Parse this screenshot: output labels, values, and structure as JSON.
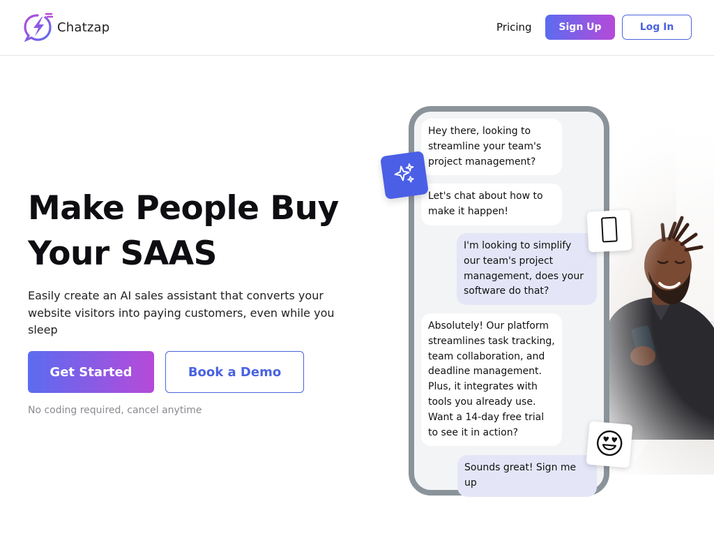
{
  "header": {
    "brand": "Chatzap",
    "nav_pricing": "Pricing",
    "signup_label": "Sign Up",
    "login_label": "Log In"
  },
  "hero": {
    "title_line1": "Make People Buy",
    "title_line2": "Your SAAS",
    "subtitle": "Easily create an AI sales assistant that converts your website visitors into paying customers, even while you sleep",
    "primary_cta": "Get Started",
    "secondary_cta": "Book a Demo",
    "note": "No coding required, cancel anytime"
  },
  "chat": {
    "messages": [
      {
        "from": "bot",
        "text": "Hey there, looking to streamline your team's project management?"
      },
      {
        "from": "bot",
        "text": "Let's chat about how to make it happen!"
      },
      {
        "from": "user",
        "text": "I'm looking to simplify our team's project management, does your software do that?"
      },
      {
        "from": "bot",
        "text": "Absolutely! Our platform streamlines task tracking, team collaboration, and deadline management. Plus, it integrates with tools you already use. Want a 14-day free trial to see it in action?"
      },
      {
        "from": "user",
        "text": "Sounds great! Sign me up"
      }
    ]
  },
  "icons": {
    "logo": "lightning-chat-logo-icon",
    "sparkle": "sparkle-icon",
    "phone": "phone-icon",
    "heart_eyes": "heart-eyes-emoji-icon"
  },
  "colors": {
    "gradient_start": "#5b6cf0",
    "gradient_end": "#b64ad9",
    "accent_blue": "#4a63e0",
    "user_bubble": "#e4e6f7",
    "phone_frame": "#8b939a"
  }
}
